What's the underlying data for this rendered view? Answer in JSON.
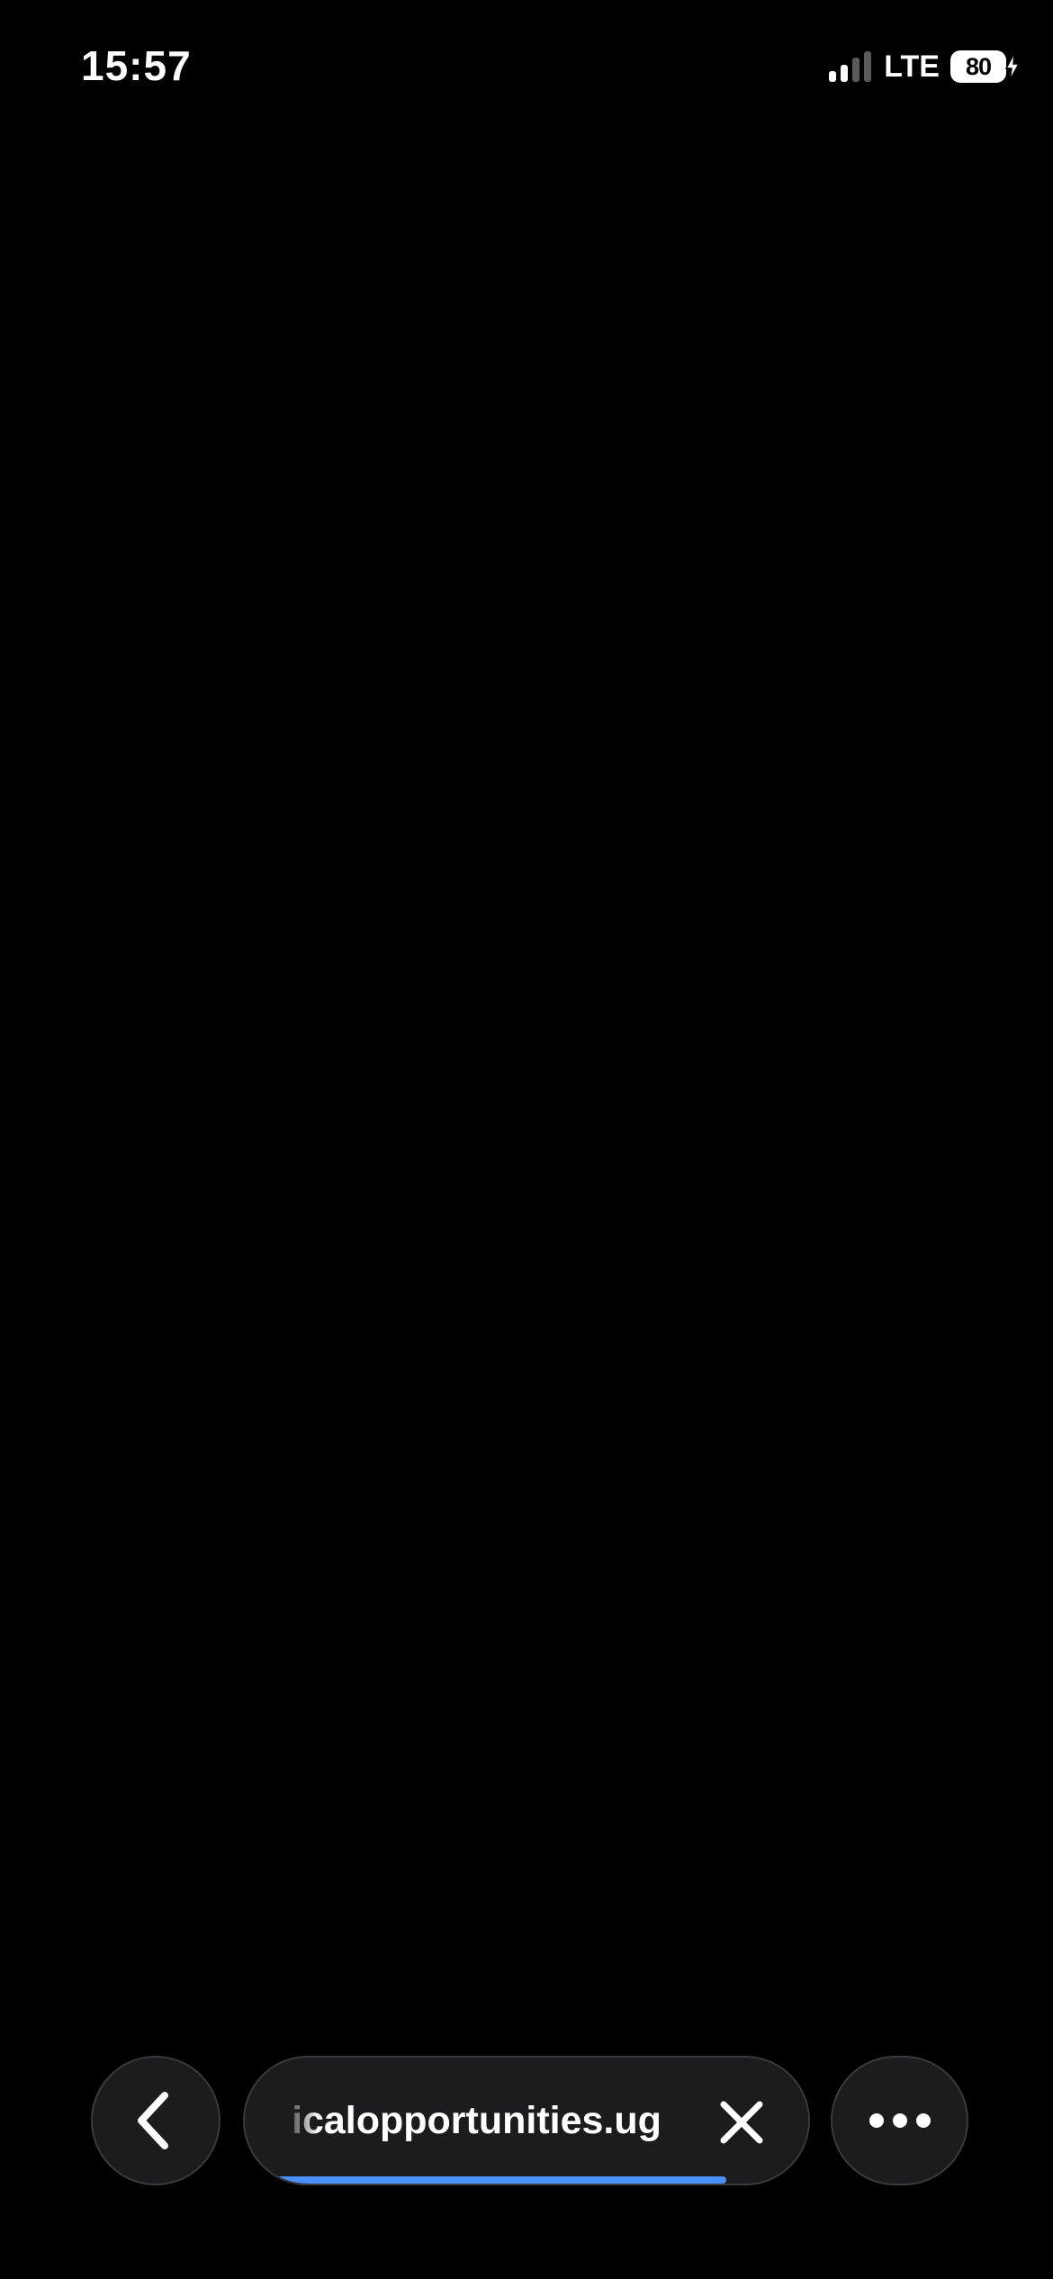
{
  "status_bar": {
    "time": "15:57",
    "network": "LTE",
    "battery_level": "80",
    "signal_bars_active": 2,
    "signal_bars_total": 4,
    "charging": true
  },
  "toolbar": {
    "back_icon": "chevron-left-icon",
    "url": "icalopportunities.ug",
    "close_icon": "close-icon",
    "more_icon": "ellipsis-icon",
    "loading_progress": 0.9,
    "accent_color": "#4a90ff"
  },
  "page": {
    "background_color": "#000000"
  }
}
